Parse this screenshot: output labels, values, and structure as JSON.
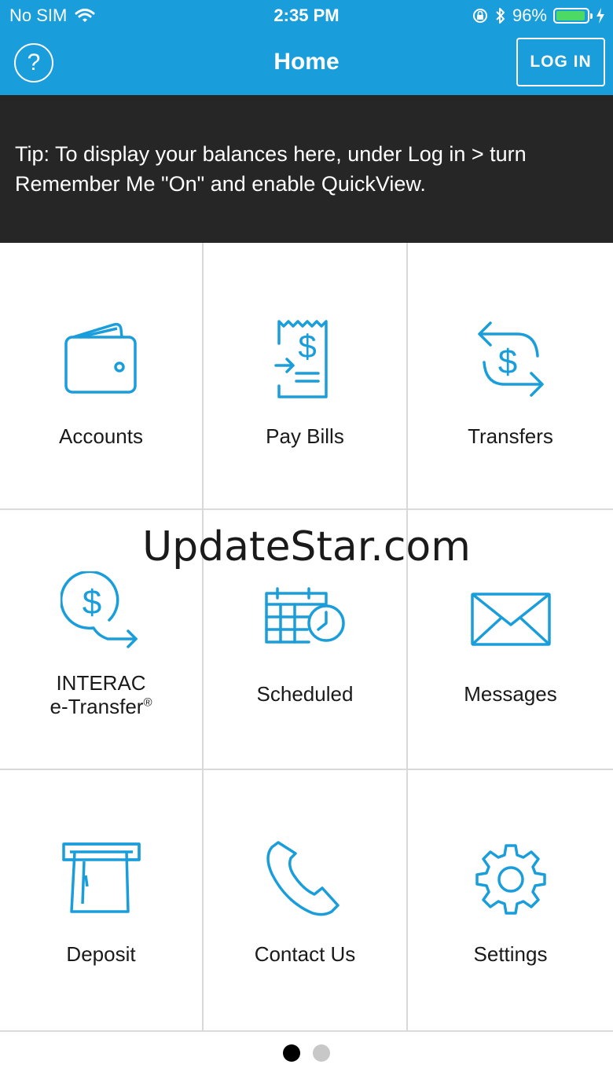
{
  "status_bar": {
    "carrier": "No SIM",
    "time": "2:35 PM",
    "battery_percent": "96%",
    "battery_level": 0.96
  },
  "nav": {
    "title": "Home",
    "help_glyph": "?",
    "login_label": "LOG IN"
  },
  "tip": {
    "text": "Tip: To display your balances here, under Log in > turn Remember Me \"On\" and enable QuickView."
  },
  "tiles": {
    "accounts": {
      "label": "Accounts",
      "icon": "wallet-icon"
    },
    "pay_bills": {
      "label": "Pay Bills",
      "icon": "bill-receipt-icon"
    },
    "transfers": {
      "label": "Transfers",
      "icon": "transfer-dollar-icon"
    },
    "etransfer": {
      "label_line1": "INTERAC",
      "label_line2": "e-Transfer",
      "label_mark": "®",
      "icon": "dollar-send-icon"
    },
    "scheduled": {
      "label": "Scheduled",
      "icon": "calendar-clock-icon"
    },
    "messages": {
      "label": "Messages",
      "icon": "envelope-icon"
    },
    "deposit": {
      "label": "Deposit",
      "icon": "atm-deposit-icon"
    },
    "contact_us": {
      "label": "Contact Us",
      "icon": "phone-icon"
    },
    "settings": {
      "label": "Settings",
      "icon": "gear-icon"
    }
  },
  "watermark": "UpdateStar.com",
  "pager": {
    "total": 2,
    "current": 1
  },
  "colors": {
    "brand_blue": "#1a9edb",
    "icon_blue": "#1a9edb",
    "tip_bg": "#262626",
    "dot_active": "#000000",
    "dot_inactive": "#c8c8c8"
  }
}
